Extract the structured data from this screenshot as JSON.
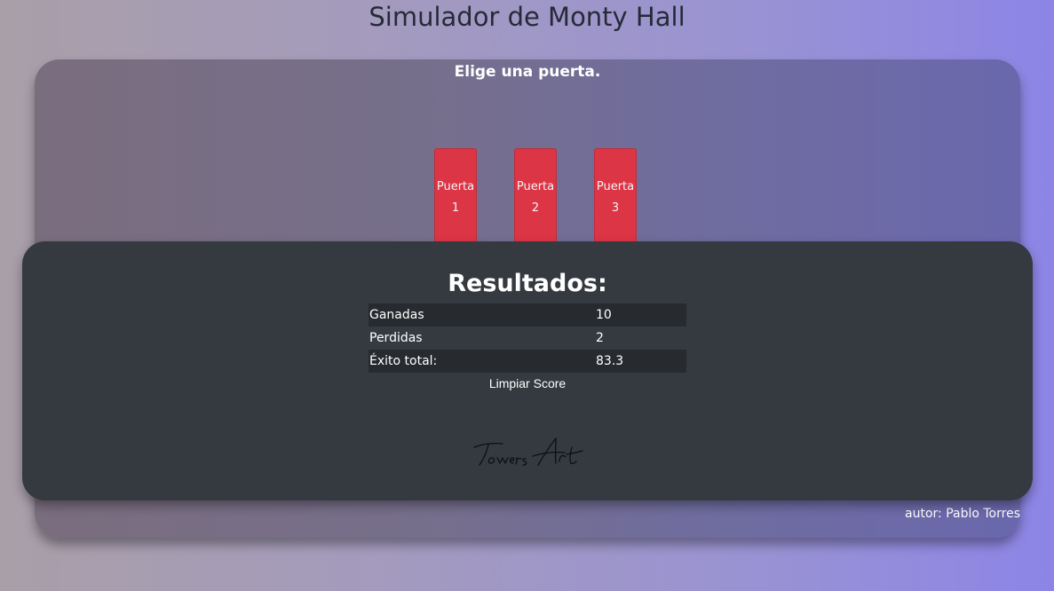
{
  "header": {
    "title": "Simulador de Monty Hall"
  },
  "game": {
    "instruction": "Elige una puerta.",
    "doors": [
      {
        "word": "Puerta",
        "number": "1"
      },
      {
        "word": "Puerta",
        "number": "2"
      },
      {
        "word": "Puerta",
        "number": "3"
      }
    ],
    "door_color": "#dc3545",
    "author": "autor: Pablo Torres"
  },
  "results": {
    "title": "Resultados:",
    "rows": [
      {
        "label": "Ganadas",
        "value": "10"
      },
      {
        "label": "Perdidas",
        "value": "2"
      },
      {
        "label": "Éxito total:",
        "value": "83.3"
      }
    ],
    "clear_label": "Limpiar Score",
    "signature": "Towers Art"
  }
}
